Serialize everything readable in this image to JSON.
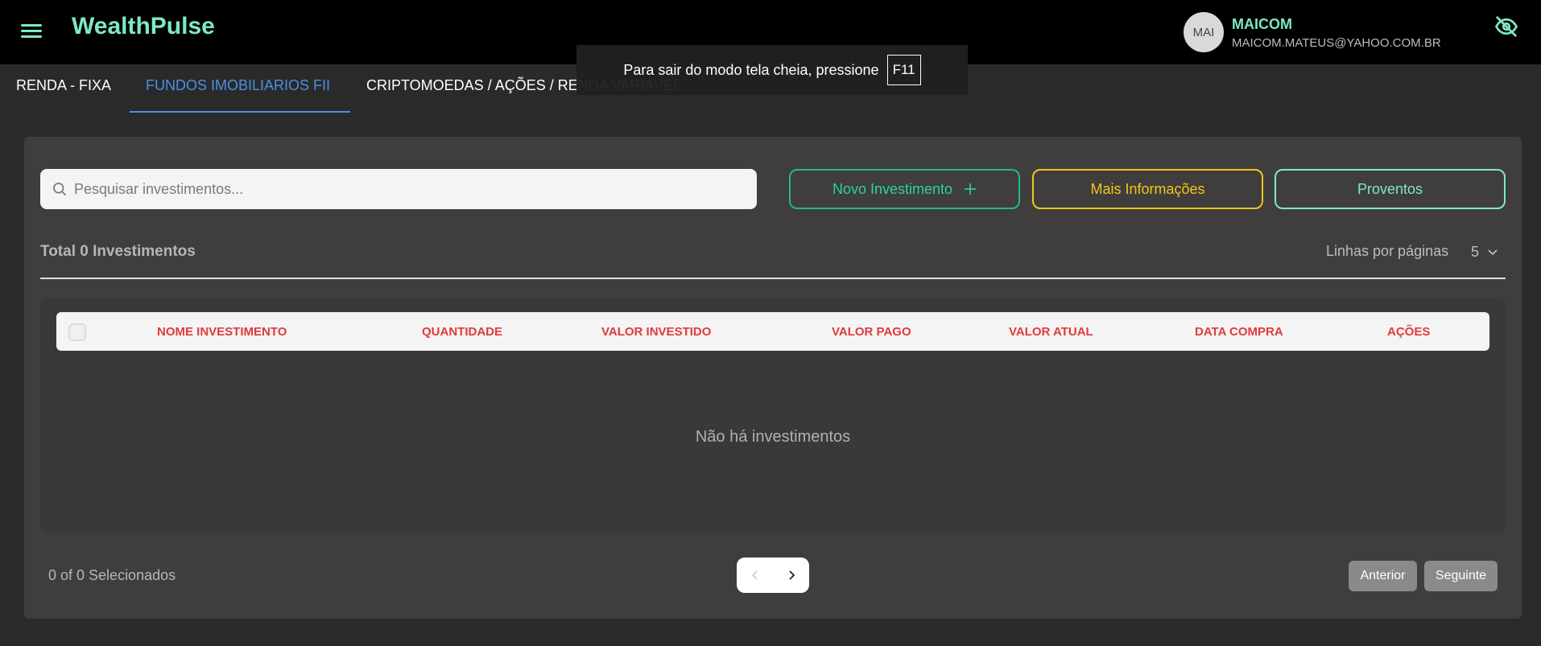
{
  "header": {
    "brand": "WealthPulse",
    "avatar_text": "MAI",
    "user_name": "MAICOM",
    "user_email": "MAICOM.MATEUS@YAHOO.COM.BR"
  },
  "toast": {
    "message": "Para sair do modo tela cheia, pressione",
    "key": "F11"
  },
  "tabs": [
    {
      "label": "RENDA - FIXA"
    },
    {
      "label": "FUNDOS IMOBILIARIOS FII"
    },
    {
      "label": "CRIPTOMOEDAS / AÇÕES / RENDA VARIÁVEL"
    }
  ],
  "toolbar": {
    "search_placeholder": "Pesquisar investimentos...",
    "new_label": "Novo Investimento",
    "info_label": "Mais Informações",
    "proventos_label": "Proventos"
  },
  "summary": {
    "total_label": "Total 0 Investimentos",
    "rows_label": "Linhas por páginas",
    "rows_value": "5"
  },
  "table": {
    "columns": [
      "NOME INVESTIMENTO",
      "QUANTIDADE",
      "VALOR INVESTIDO",
      "VALOR PAGO",
      "VALOR ATUAL",
      "DATA COMPRA",
      "AÇÕES"
    ],
    "empty_message": "Não há investimentos"
  },
  "footer": {
    "selected_label": "0 of 0 Selecionados",
    "prev_label": "Anterior",
    "next_label": "Seguinte"
  },
  "colors": {
    "accent_mint": "#7ee8c6",
    "accent_blue": "#4a90e2",
    "accent_yellow": "#f5c518",
    "header_red": "#e03a3a"
  }
}
